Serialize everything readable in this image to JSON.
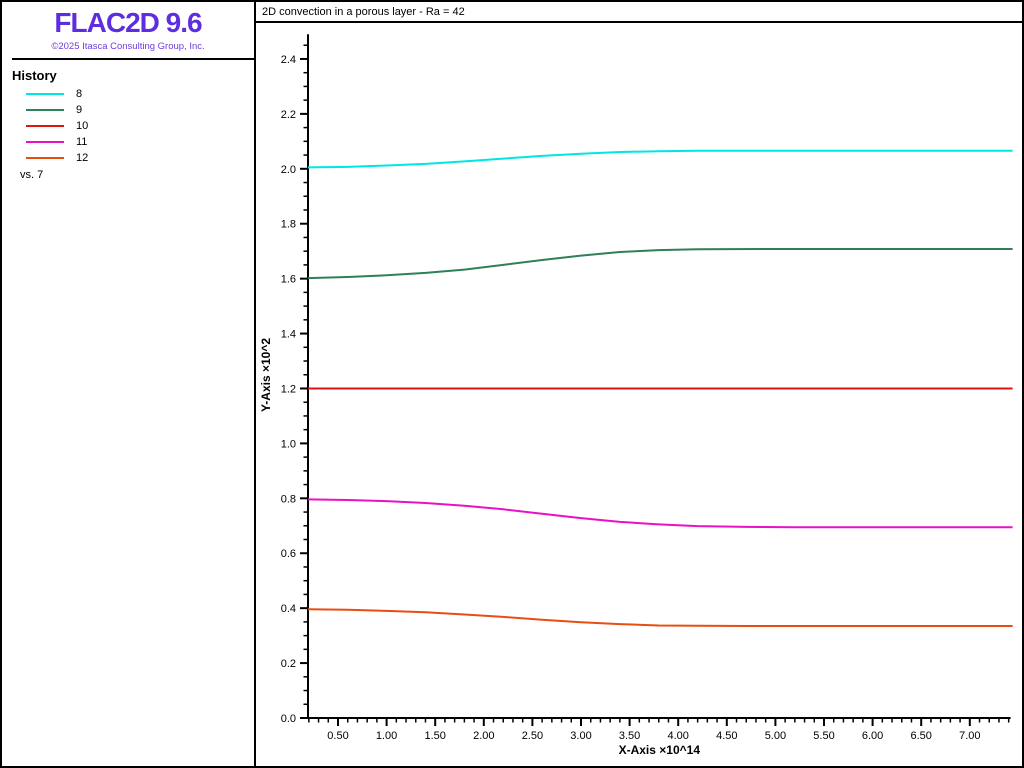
{
  "sidebar": {
    "logo": "FLAC2D 9.6",
    "logo_color": "#5d2ee0",
    "copyright": "©2025 Itasca Consulting Group, Inc.",
    "copyright_color": "#6e3ddd",
    "history_title": "History",
    "legend": [
      {
        "id": "8",
        "color": "#00e5e5"
      },
      {
        "id": "9",
        "color": "#2e8057"
      },
      {
        "id": "10",
        "color": "#e01313"
      },
      {
        "id": "11",
        "color": "#ea10c5"
      },
      {
        "id": "12",
        "color": "#e94e11"
      }
    ],
    "vs_label": "vs. 7"
  },
  "chart": {
    "title": "2D convection in a porous layer - Ra = 42"
  },
  "chart_data": {
    "type": "line",
    "title": "2D convection in a porous layer - Ra = 42",
    "xlabel": "X-Axis ×10^14",
    "ylabel": "Y-Axis ×10^2",
    "xlim": [
      0.19,
      7.44
    ],
    "ylim": [
      0.0,
      2.49
    ],
    "grid": false,
    "legend_position": "left-sidebar",
    "x_major_ticks": [
      0.5,
      1.0,
      1.5,
      2.0,
      2.5,
      3.0,
      3.5,
      4.0,
      4.5,
      5.0,
      5.5,
      6.0,
      6.5,
      7.0
    ],
    "x_tick_labels": [
      "0.50",
      "1.00",
      "1.50",
      "2.00",
      "2.50",
      "3.00",
      "3.50",
      "4.00",
      "4.50",
      "5.00",
      "5.50",
      "6.00",
      "6.50",
      "7.00"
    ],
    "x_minor_step": 0.1,
    "y_major_ticks": [
      0.0,
      0.2,
      0.4,
      0.6,
      0.8,
      1.0,
      1.2,
      1.4,
      1.6,
      1.8,
      2.0,
      2.2,
      2.4
    ],
    "y_tick_labels": [
      "0.0",
      "0.2",
      "0.4",
      "0.6",
      "0.8",
      "1.0",
      "1.2",
      "1.4",
      "1.6",
      "1.8",
      "2.0",
      "2.2",
      "2.4"
    ],
    "y_minor_step": 0.05,
    "series": [
      {
        "name": "8",
        "color": "#00e5e5",
        "points": [
          [
            0.19,
            2.005
          ],
          [
            0.6,
            2.007
          ],
          [
            1.0,
            2.012
          ],
          [
            1.4,
            2.018
          ],
          [
            1.8,
            2.027
          ],
          [
            2.2,
            2.037
          ],
          [
            2.6,
            2.047
          ],
          [
            3.0,
            2.055
          ],
          [
            3.4,
            2.061
          ],
          [
            3.8,
            2.064
          ],
          [
            4.2,
            2.066
          ],
          [
            5.0,
            2.066
          ],
          [
            7.44,
            2.066
          ]
        ]
      },
      {
        "name": "9",
        "color": "#2e8057",
        "points": [
          [
            0.19,
            1.602
          ],
          [
            0.6,
            1.606
          ],
          [
            1.0,
            1.612
          ],
          [
            1.4,
            1.621
          ],
          [
            1.8,
            1.633
          ],
          [
            2.2,
            1.65
          ],
          [
            2.6,
            1.668
          ],
          [
            3.0,
            1.684
          ],
          [
            3.4,
            1.697
          ],
          [
            3.8,
            1.704
          ],
          [
            4.2,
            1.707
          ],
          [
            5.0,
            1.708
          ],
          [
            7.44,
            1.708
          ]
        ]
      },
      {
        "name": "10",
        "color": "#e01313",
        "points": [
          [
            0.19,
            1.2
          ],
          [
            7.44,
            1.2
          ]
        ]
      },
      {
        "name": "11",
        "color": "#ea10c5",
        "points": [
          [
            0.19,
            0.796
          ],
          [
            0.6,
            0.794
          ],
          [
            1.0,
            0.79
          ],
          [
            1.4,
            0.783
          ],
          [
            1.8,
            0.773
          ],
          [
            2.2,
            0.76
          ],
          [
            2.6,
            0.744
          ],
          [
            3.0,
            0.728
          ],
          [
            3.4,
            0.714
          ],
          [
            3.8,
            0.705
          ],
          [
            4.2,
            0.699
          ],
          [
            4.7,
            0.696
          ],
          [
            5.2,
            0.695
          ],
          [
            7.44,
            0.695
          ]
        ]
      },
      {
        "name": "12",
        "color": "#e94e11",
        "points": [
          [
            0.19,
            0.396
          ],
          [
            0.6,
            0.394
          ],
          [
            1.0,
            0.39
          ],
          [
            1.4,
            0.385
          ],
          [
            1.8,
            0.377
          ],
          [
            2.2,
            0.368
          ],
          [
            2.6,
            0.358
          ],
          [
            3.0,
            0.349
          ],
          [
            3.4,
            0.342
          ],
          [
            3.8,
            0.337
          ],
          [
            4.2,
            0.336
          ],
          [
            4.7,
            0.335
          ],
          [
            7.44,
            0.335
          ]
        ]
      }
    ]
  }
}
